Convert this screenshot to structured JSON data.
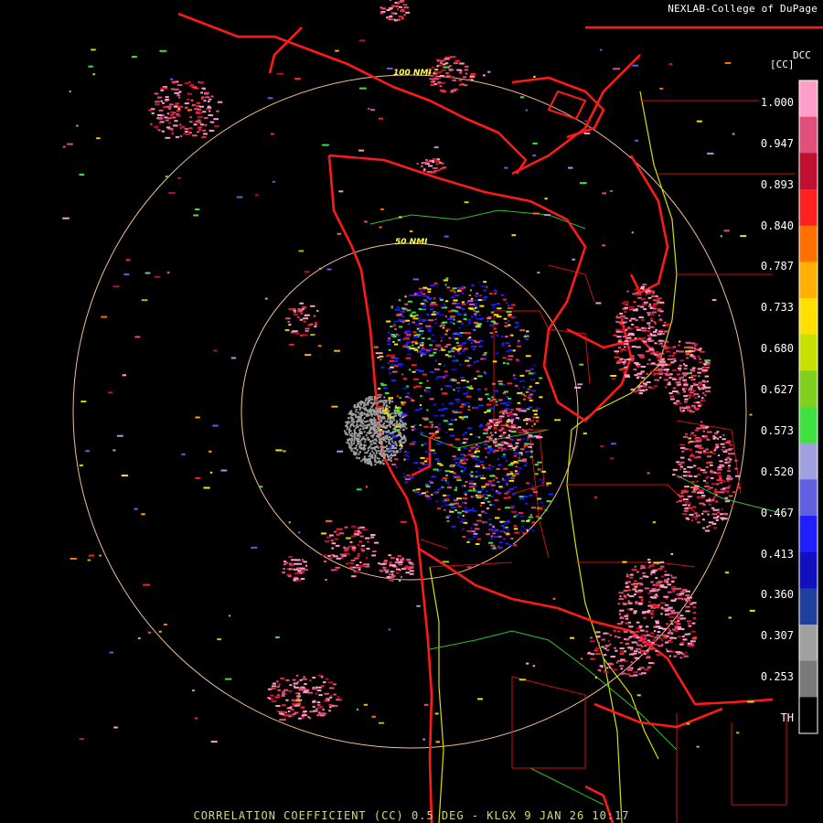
{
  "credit": "NEXLAB-College of DuPage",
  "footer": "CORRELATION COEFFICIENT (CC) 0.5 DEG - KLGX 9 JAN 26 10:17",
  "legend": {
    "product": "DCC",
    "unit": "[CC]",
    "labels": [
      "1.000",
      "0.947",
      "0.893",
      "0.840",
      "0.787",
      "0.733",
      "0.680",
      "0.627",
      "0.573",
      "0.520",
      "0.467",
      "0.413",
      "0.360",
      "0.307",
      "0.253",
      "TH"
    ],
    "colors": [
      "#ff9ec8",
      "#e0507a",
      "#c01030",
      "#ff2020",
      "#ff7000",
      "#ffb000",
      "#ffe000",
      "#c8e000",
      "#80d020",
      "#40e040",
      "#a0a0e0",
      "#6060e0",
      "#2020ff",
      "#1010c0",
      "#2040a0",
      "#a0a0a0",
      "#7a7a7a",
      "#000000"
    ]
  },
  "rings": [
    {
      "label": "50 NMI"
    },
    {
      "label": "100 NMI"
    }
  ],
  "colors": {
    "border": "#ff1a1a",
    "county": "#cc1111",
    "highway": "#d8e000",
    "river": "#30c030",
    "ring": "#f0c090",
    "clutter": "#a0a0a0",
    "precip_pink": "#ff80b0",
    "precip_red": "#e02040"
  }
}
